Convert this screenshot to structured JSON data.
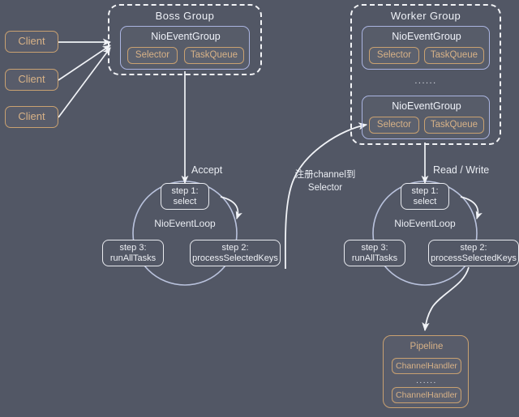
{
  "diagram": {
    "title": "Netty Boss/Worker Group NioEventLoop model",
    "background_color": "#525765",
    "colors": {
      "tan_border": "#c9a171",
      "tan_text": "#d8b287",
      "lavender_border": "#aab4e0",
      "white_line": "#eef0f5",
      "loop_circle": "#b9c2dd"
    }
  },
  "clients": [
    {
      "label": "Client"
    },
    {
      "label": "Client"
    },
    {
      "label": "Client"
    }
  ],
  "boss_group": {
    "title": "Boss Group",
    "event_groups": [
      {
        "label": "NioEventGroup",
        "selector": "Selector",
        "task_queue": "TaskQueue"
      }
    ]
  },
  "worker_group": {
    "title": "Worker Group",
    "ellipsis": "......",
    "event_groups": [
      {
        "label": "NioEventGroup",
        "selector": "Selector",
        "task_queue": "TaskQueue"
      },
      {
        "label": "NioEventGroup",
        "selector": "Selector",
        "task_queue": "TaskQueue"
      }
    ]
  },
  "boss_loop": {
    "incoming_label": "Accept",
    "loop_label": "NioEventLoop",
    "steps": [
      {
        "line1": "step 1:",
        "line2": "select"
      },
      {
        "line1": "step 2:",
        "line2": "processSelectedKeys"
      },
      {
        "line1": "step 3:",
        "line2": "runAllTasks"
      }
    ]
  },
  "worker_loop": {
    "incoming_label": "Read / Write",
    "loop_label": "NioEventLoop",
    "steps": [
      {
        "line1": "step 1:",
        "line2": "select"
      },
      {
        "line1": "step 2:",
        "line2": "processSelectedKeys"
      },
      {
        "line1": "step 3:",
        "line2": "runAllTasks"
      }
    ]
  },
  "register_arrow": {
    "line1": "注册channel到",
    "line2": "Selector"
  },
  "pipeline": {
    "title": "Pipeline",
    "ellipsis": "......",
    "handlers": [
      {
        "label": "ChannelHandler"
      },
      {
        "label": "ChannelHandler"
      }
    ]
  }
}
